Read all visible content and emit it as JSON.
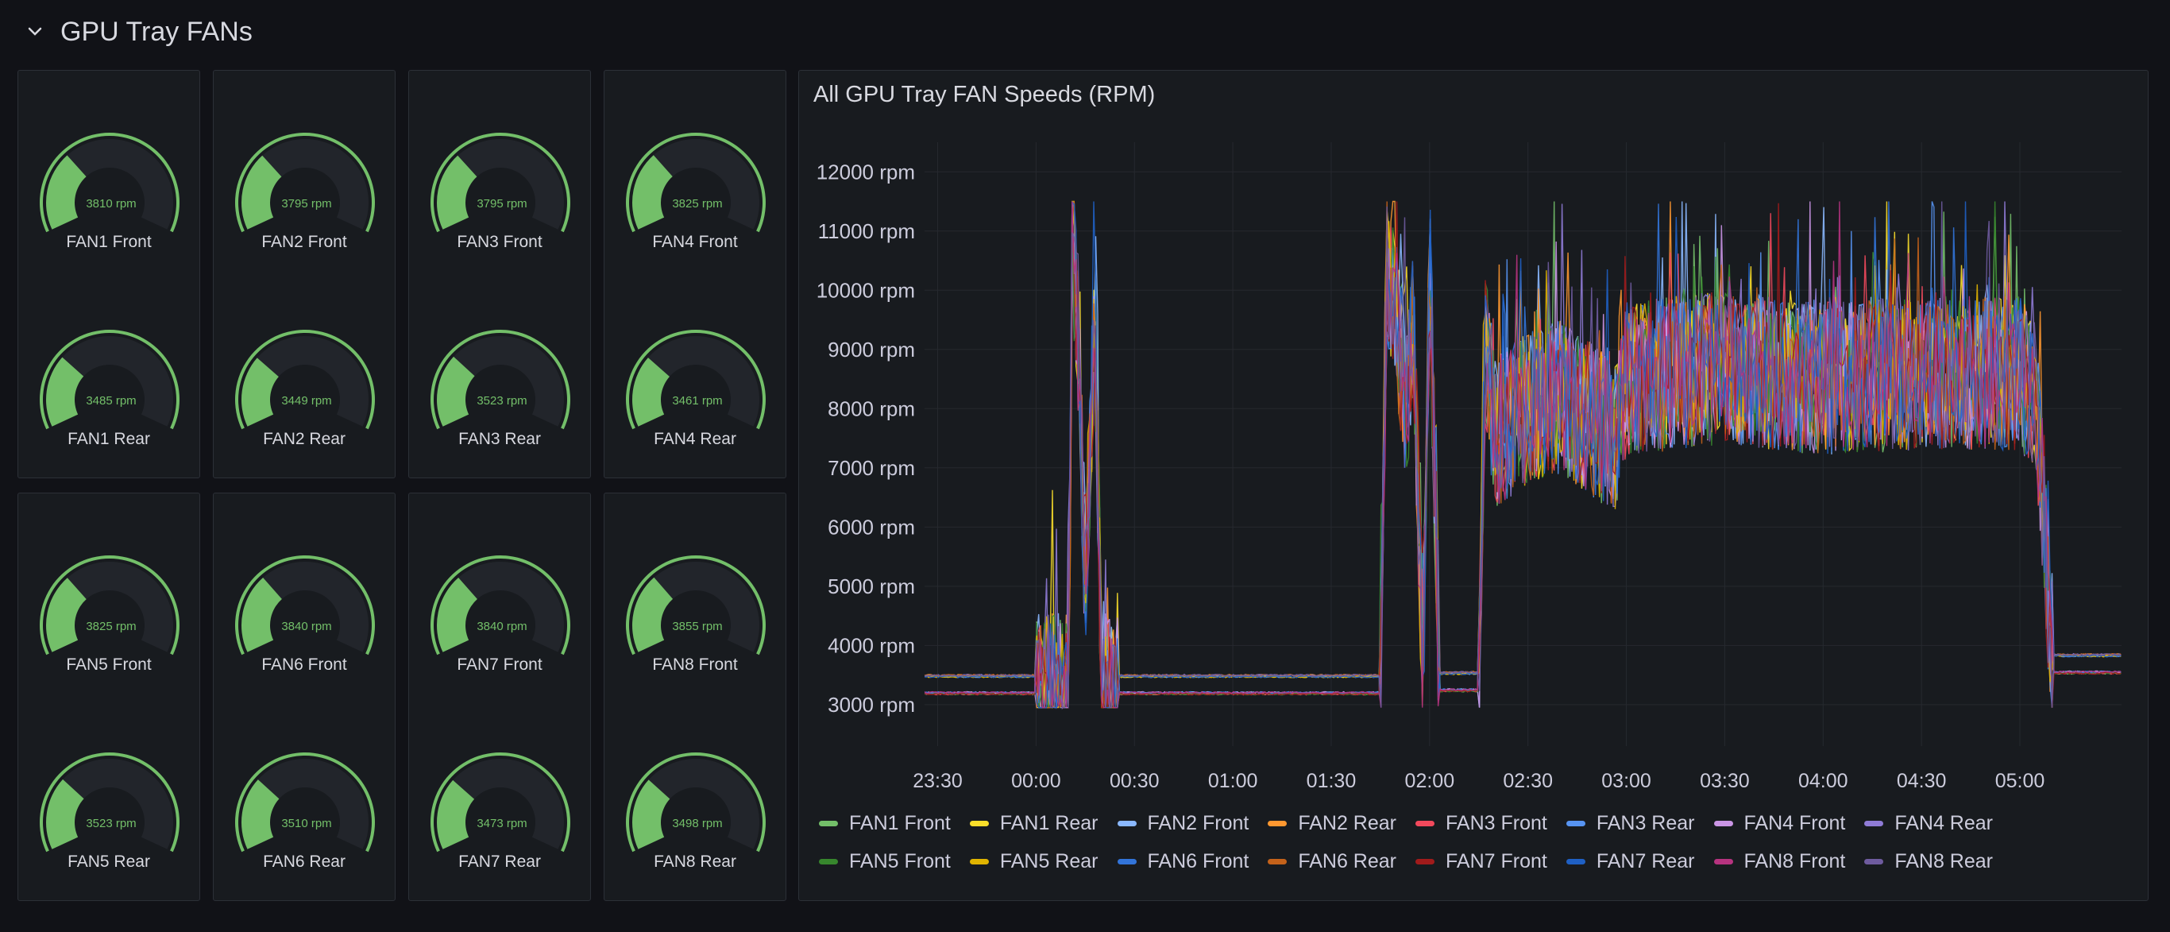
{
  "row": {
    "title": "GPU Tray FANs",
    "chevron_icon": "chevron-down-icon"
  },
  "gauge_color": "#73bf69",
  "gauges": [
    {
      "label": "FAN1 Front",
      "value": 3810,
      "display": "3810 rpm"
    },
    {
      "label": "FAN2 Front",
      "value": 3795,
      "display": "3795 rpm"
    },
    {
      "label": "FAN3 Front",
      "value": 3795,
      "display": "3795 rpm"
    },
    {
      "label": "FAN4 Front",
      "value": 3825,
      "display": "3825 rpm"
    },
    {
      "label": "FAN1 Rear",
      "value": 3485,
      "display": "3485 rpm"
    },
    {
      "label": "FAN2 Rear",
      "value": 3449,
      "display": "3449 rpm"
    },
    {
      "label": "FAN3 Rear",
      "value": 3523,
      "display": "3523 rpm"
    },
    {
      "label": "FAN4 Rear",
      "value": 3461,
      "display": "3461 rpm"
    },
    {
      "label": "FAN5 Front",
      "value": 3825,
      "display": "3825 rpm"
    },
    {
      "label": "FAN6 Front",
      "value": 3840,
      "display": "3840 rpm"
    },
    {
      "label": "FAN7 Front",
      "value": 3840,
      "display": "3840 rpm"
    },
    {
      "label": "FAN8 Front",
      "value": 3855,
      "display": "3855 rpm"
    },
    {
      "label": "FAN5 Rear",
      "value": 3523,
      "display": "3523 rpm"
    },
    {
      "label": "FAN6 Rear",
      "value": 3510,
      "display": "3510 rpm"
    },
    {
      "label": "FAN7 Rear",
      "value": 3473,
      "display": "3473 rpm"
    },
    {
      "label": "FAN8 Rear",
      "value": 3498,
      "display": "3498 rpm"
    }
  ],
  "chart": {
    "title": "All GPU Tray FAN Speeds (RPM)"
  },
  "chart_data": {
    "type": "line",
    "title": "All GPU Tray FAN Speeds (RPM)",
    "xlabel": "",
    "ylabel": "",
    "y_unit": "rpm",
    "ylim": [
      2300,
      12500
    ],
    "y_ticks": [
      {
        "value": 3000,
        "label": "3000 rpm"
      },
      {
        "value": 4000,
        "label": "4000 rpm"
      },
      {
        "value": 5000,
        "label": "5000 rpm"
      },
      {
        "value": 6000,
        "label": "6000 rpm"
      },
      {
        "value": 7000,
        "label": "7000 rpm"
      },
      {
        "value": 8000,
        "label": "8000 rpm"
      },
      {
        "value": 9000,
        "label": "9000 rpm"
      },
      {
        "value": 10000,
        "label": "10000 rpm"
      },
      {
        "value": 11000,
        "label": "11000 rpm"
      },
      {
        "value": 12000,
        "label": "12000 rpm"
      }
    ],
    "x_ticks": [
      "23:30",
      "00:00",
      "00:30",
      "01:00",
      "01:30",
      "02:00",
      "02:30",
      "03:00",
      "03:30",
      "04:00",
      "04:30",
      "05:00"
    ],
    "x_tick_times": [
      "23:30",
      "00:00",
      "00:30",
      "01:00",
      "01:30",
      "02:00",
      "02:30",
      "03:00",
      "03:30",
      "04:00",
      "04:30",
      "05:00"
    ],
    "x_range": [
      "23:26",
      "05:31"
    ],
    "grid": true,
    "legend_position": "bottom",
    "series": [
      {
        "name": "FAN1 Front",
        "color": "#73bf69"
      },
      {
        "name": "FAN1 Rear",
        "color": "#fade2a"
      },
      {
        "name": "FAN2 Front",
        "color": "#8ab8ff"
      },
      {
        "name": "FAN2 Rear",
        "color": "#ff9830"
      },
      {
        "name": "FAN3 Front",
        "color": "#f2495c"
      },
      {
        "name": "FAN3 Rear",
        "color": "#5794f2"
      },
      {
        "name": "FAN4 Front",
        "color": "#ca95e5"
      },
      {
        "name": "FAN4 Rear",
        "color": "#8f7bd6"
      },
      {
        "name": "FAN5 Front",
        "color": "#37872d"
      },
      {
        "name": "FAN5 Rear",
        "color": "#e0b400"
      },
      {
        "name": "FAN6 Front",
        "color": "#3274d9"
      },
      {
        "name": "FAN6 Rear",
        "color": "#c4621a"
      },
      {
        "name": "FAN7 Front",
        "color": "#a11b1b"
      },
      {
        "name": "FAN7 Rear",
        "color": "#1f60c4"
      },
      {
        "name": "FAN8 Front",
        "color": "#b6337f"
      },
      {
        "name": "FAN8 Rear",
        "color": "#6e5b9e"
      }
    ],
    "profile": {
      "time": [
        "23:26",
        "00:10",
        "00:11",
        "00:13",
        "00:15",
        "00:18",
        "00:20",
        "00:22",
        "00:25",
        "01:45",
        "01:47",
        "01:50",
        "01:53",
        "01:55",
        "01:58",
        "02:00",
        "02:03",
        "02:15",
        "02:17",
        "02:20",
        "02:30",
        "02:40",
        "02:57",
        "03:00",
        "03:30",
        "04:00",
        "04:30",
        "05:00",
        "05:05",
        "05:10",
        "05:31"
      ],
      "rpm": [
        3250,
        3250,
        11000,
        9000,
        5000,
        9500,
        3300,
        3250,
        3250,
        3250,
        10500,
        9500,
        8000,
        9500,
        3300,
        10500,
        3300,
        3300,
        9000,
        7600,
        8000,
        8200,
        7500,
        8500,
        8700,
        8500,
        8600,
        8600,
        8200,
        3600,
        3600
      ]
    }
  }
}
